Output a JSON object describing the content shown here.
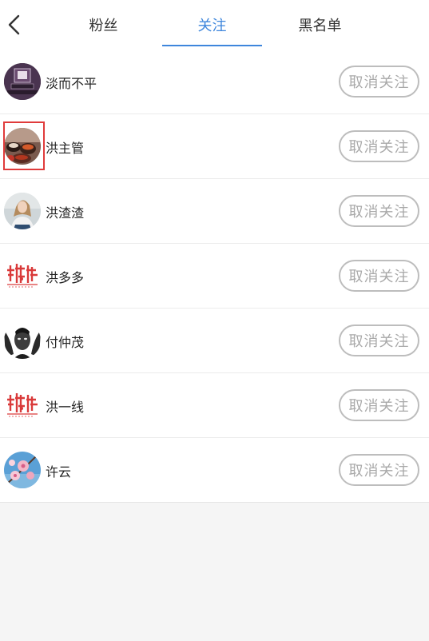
{
  "tabs": [
    {
      "label": "粉丝",
      "active": false
    },
    {
      "label": "关注",
      "active": true
    },
    {
      "label": "黑名单",
      "active": false
    }
  ],
  "follow_list": [
    {
      "name": "淡而不平",
      "button": "取消关注",
      "avatar": "badge-portrait"
    },
    {
      "name": "洪主管",
      "button": "取消关注",
      "avatar": "food-photo"
    },
    {
      "name": "洪渣渣",
      "button": "取消关注",
      "avatar": "woman-photo"
    },
    {
      "name": "洪多多",
      "button": "取消关注",
      "avatar": "red-calligraphy-logo"
    },
    {
      "name": "付仲茂",
      "button": "取消关注",
      "avatar": "bw-man-portrait"
    },
    {
      "name": "洪一线",
      "button": "取消关注",
      "avatar": "red-calligraphy-logo"
    },
    {
      "name": "许云",
      "button": "取消关注",
      "avatar": "pink-blossom-photo"
    }
  ],
  "colors": {
    "accent": "#3e86dc",
    "highlight": "#e03b3b",
    "button_text": "#a9a9a9"
  }
}
